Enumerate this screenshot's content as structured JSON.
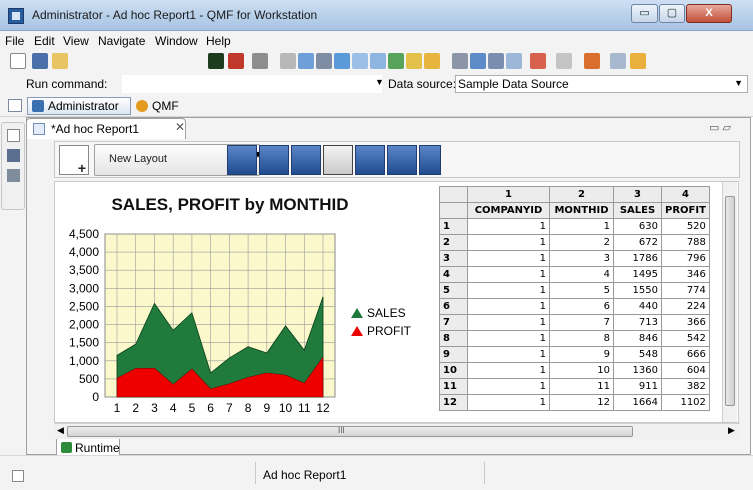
{
  "window": {
    "title": "Administrator - Ad hoc Report1 - QMF for Workstation",
    "min_glyph": "▭",
    "max_glyph": "▢",
    "close_glyph": "X"
  },
  "menu": [
    "File",
    "Edit",
    "View",
    "Navigate",
    "Window",
    "Help"
  ],
  "run": {
    "label": "Run command:",
    "value": "",
    "ds_label": "Data source:",
    "ds_value": "Sample Data Source"
  },
  "perspectives": {
    "admin": "Administrator",
    "qmf": "QMF"
  },
  "editor": {
    "tab_label": "*Ad hoc Report1",
    "tab_close": "✕",
    "minmax": "▭ ▱",
    "new_layout_label": "New Layout",
    "runtime_tab": "Runtime",
    "hscroll_mark": "III"
  },
  "status": {
    "text": "Ad hoc Report1"
  },
  "icons": {
    "title": "qmf-app-icon",
    "layout": [
      "new-layout-icon",
      "layout-form-icon",
      "layout-form2-icon",
      "layout-chart-icon",
      "eraser-icon",
      "layout-chart2-icon",
      "layout-image-icon",
      "layout-export-icon"
    ]
  },
  "colors": {
    "sales": "#1f7a3c",
    "profit": "#ee0000",
    "plot_bg": "#fbf9cc"
  },
  "chart_data": {
    "type": "area",
    "title": "SALES, PROFIT by MONTHID",
    "x": [
      1,
      2,
      3,
      4,
      5,
      6,
      7,
      8,
      9,
      10,
      11,
      12
    ],
    "ylim": [
      0,
      4500
    ],
    "yticks": [
      0,
      500,
      1000,
      1500,
      2000,
      2500,
      3000,
      3500,
      4000,
      4500
    ],
    "ytick_labels": [
      "0",
      "500",
      "1,000",
      "1,500",
      "2,000",
      "2,500",
      "3,000",
      "3,500",
      "4,000",
      "4,500"
    ],
    "stacked": true,
    "grid": true,
    "legend_placement": "right",
    "series": [
      {
        "name": "SALES",
        "values": [
          630,
          672,
          1786,
          1495,
          1550,
          440,
          713,
          846,
          548,
          1360,
          911,
          1664
        ]
      },
      {
        "name": "PROFIT",
        "values": [
          520,
          788,
          796,
          346,
          774,
          224,
          366,
          542,
          666,
          604,
          382,
          1102
        ]
      }
    ]
  },
  "grid": {
    "col_numbers": [
      "1",
      "2",
      "3",
      "4"
    ],
    "headers": [
      "COMPANYID",
      "MONTHID",
      "SALES",
      "PROFIT"
    ],
    "rows": [
      [
        "1",
        "1",
        "1",
        "630",
        "520"
      ],
      [
        "2",
        "1",
        "2",
        "672",
        "788"
      ],
      [
        "3",
        "1",
        "3",
        "1786",
        "796"
      ],
      [
        "4",
        "1",
        "4",
        "1495",
        "346"
      ],
      [
        "5",
        "1",
        "5",
        "1550",
        "774"
      ],
      [
        "6",
        "1",
        "6",
        "440",
        "224"
      ],
      [
        "7",
        "1",
        "7",
        "713",
        "366"
      ],
      [
        "8",
        "1",
        "8",
        "846",
        "542"
      ],
      [
        "9",
        "1",
        "9",
        "548",
        "666"
      ],
      [
        "10",
        "1",
        "10",
        "1360",
        "604"
      ],
      [
        "11",
        "1",
        "11",
        "911",
        "382"
      ],
      [
        "12",
        "1",
        "12",
        "1664",
        "1102"
      ]
    ]
  }
}
